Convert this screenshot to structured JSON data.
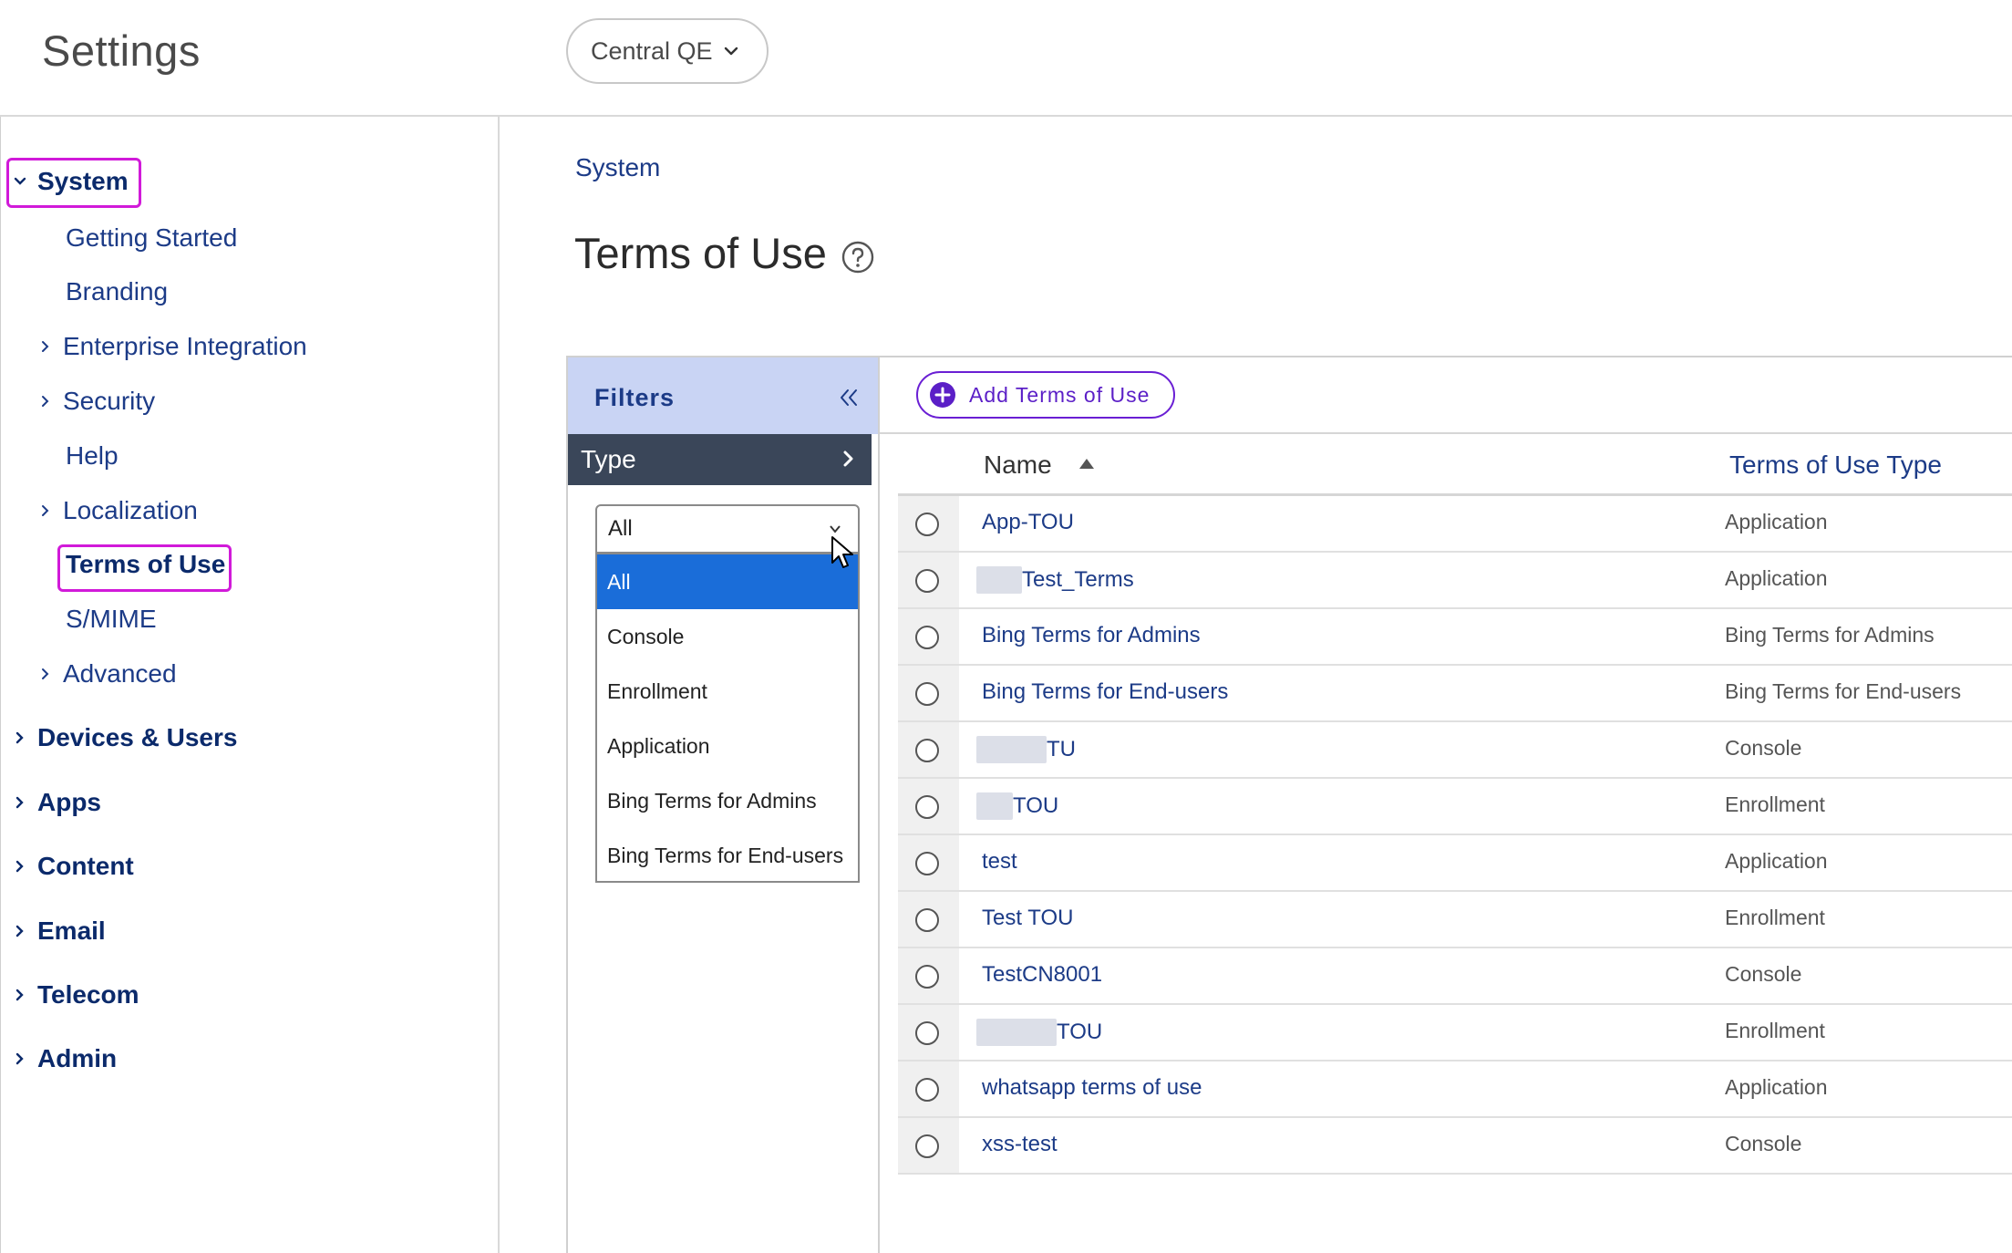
{
  "header": {
    "app_title": "Settings",
    "org_selector": "Central QE"
  },
  "sidebar": {
    "system": "System",
    "system_items": [
      "Getting Started",
      "Branding",
      "Enterprise Integration",
      "Security",
      "Help",
      "Localization",
      "Terms of Use",
      "S/MIME",
      "Advanced"
    ],
    "top_items": [
      "Devices & Users",
      "Apps",
      "Content",
      "Email",
      "Telecom",
      "Admin"
    ]
  },
  "main": {
    "breadcrumb": "System",
    "page_title": "Terms of Use"
  },
  "filters": {
    "label": "Filters",
    "type_label": "Type",
    "selected": "All",
    "options": [
      "All",
      "Console",
      "Enrollment",
      "Application",
      "Bing Terms for Admins",
      "Bing Terms for End-users"
    ]
  },
  "toolbar": {
    "add_label": "Add Terms of Use"
  },
  "table": {
    "columns": [
      "Name",
      "Terms of Use Type"
    ],
    "rows": [
      {
        "name": "App-TOU",
        "type": "Application"
      },
      {
        "name": "Test_Terms",
        "type": "Application"
      },
      {
        "name": "Bing Terms for Admins",
        "type": "Bing Terms for Admins"
      },
      {
        "name": "Bing Terms for End-users",
        "type": "Bing Terms for End-users"
      },
      {
        "name": "TU",
        "type": "Console"
      },
      {
        "name": "TOU",
        "type": "Enrollment"
      },
      {
        "name": "test",
        "type": "Application"
      },
      {
        "name": "Test TOU",
        "type": "Enrollment"
      },
      {
        "name": "TestCN8001",
        "type": "Console"
      },
      {
        "name": "TOU",
        "type": "Enrollment"
      },
      {
        "name": "whatsapp terms of use",
        "type": "Application"
      },
      {
        "name": "xss-test",
        "type": "Console"
      }
    ]
  },
  "colors": {
    "nav_text": "#0b2a6b",
    "link": "#1c3b87",
    "highlight": "#d11ad9",
    "accent": "#6a1fd4",
    "selected_option": "#1a6dd9",
    "filters_header": "#c9d4f4",
    "type_bar": "#3a4659"
  }
}
